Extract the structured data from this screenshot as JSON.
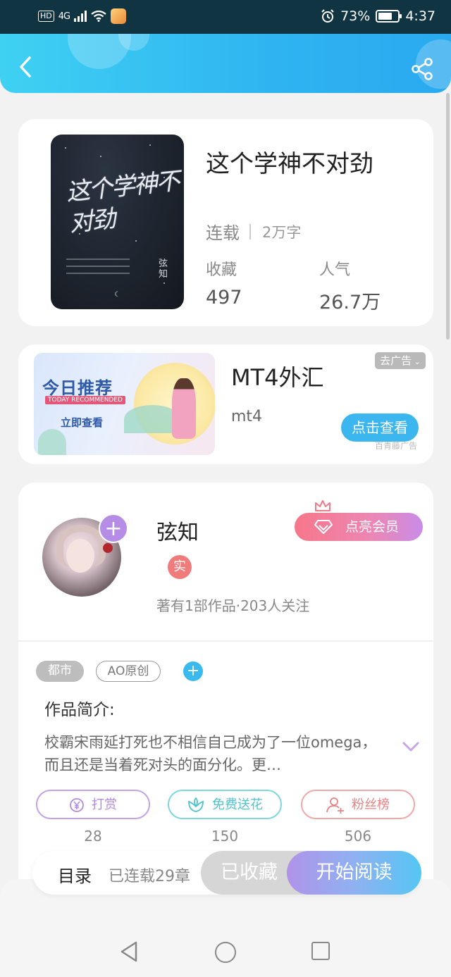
{
  "status_bar": {
    "hd": "HD",
    "network": "4G",
    "battery_percent": "73%",
    "battery_level": 0.73,
    "time": "4:37"
  },
  "header": {
    "back_icon": "chevron-left-icon",
    "share_icon": "share-icon",
    "gradient_start": "#3fd1f2",
    "gradient_end": "#2aa9ef"
  },
  "book": {
    "title": "这个学神不对劲",
    "cover_title": "这个学神不对劲",
    "cover_author": "弦知",
    "status": "连载",
    "word_count": "2万字",
    "favorites_label": "收藏",
    "favorites_value": "497",
    "popularity_label": "人气",
    "popularity_value": "26.7万"
  },
  "ad": {
    "image_title": "今日推荐",
    "image_subtitle": "TODAY RECOMMENDED",
    "image_cta": "立即查看",
    "title": "MT4外汇",
    "subtitle": "mt4",
    "remove_label": "去广告",
    "cta_label": "点击查看",
    "source_label": "百青藤广告"
  },
  "author": {
    "name": "弦知",
    "verified_badge": "实",
    "meta": "著有1部作品·203人关注",
    "vip_button": "点亮会员",
    "follow_icon": "plus-icon"
  },
  "tags": [
    "都市",
    "AO原创"
  ],
  "intro": {
    "title": "作品简介:",
    "text": "校霸宋雨延打死也不相信自己成为了一位omega，而且还是当着死对头的面分化。更…"
  },
  "actions": [
    {
      "label": "打赏",
      "icon": "yen-coin-icon",
      "count": "28",
      "color": "#b08be2"
    },
    {
      "label": "免费送花",
      "icon": "flower-icon",
      "count": "150",
      "color": "#4fc3cf"
    },
    {
      "label": "粉丝榜",
      "icon": "user-rank-icon",
      "count": "506",
      "color": "#e98383"
    }
  ],
  "bottom_bar": {
    "toc_label": "目录",
    "chapters_label": "已连载29章",
    "saved_label": "已收藏",
    "read_label": "开始阅读"
  },
  "nav": {
    "back_icon": "triangle-back-icon",
    "home_icon": "circle-home-icon",
    "recent_icon": "square-recent-icon"
  }
}
